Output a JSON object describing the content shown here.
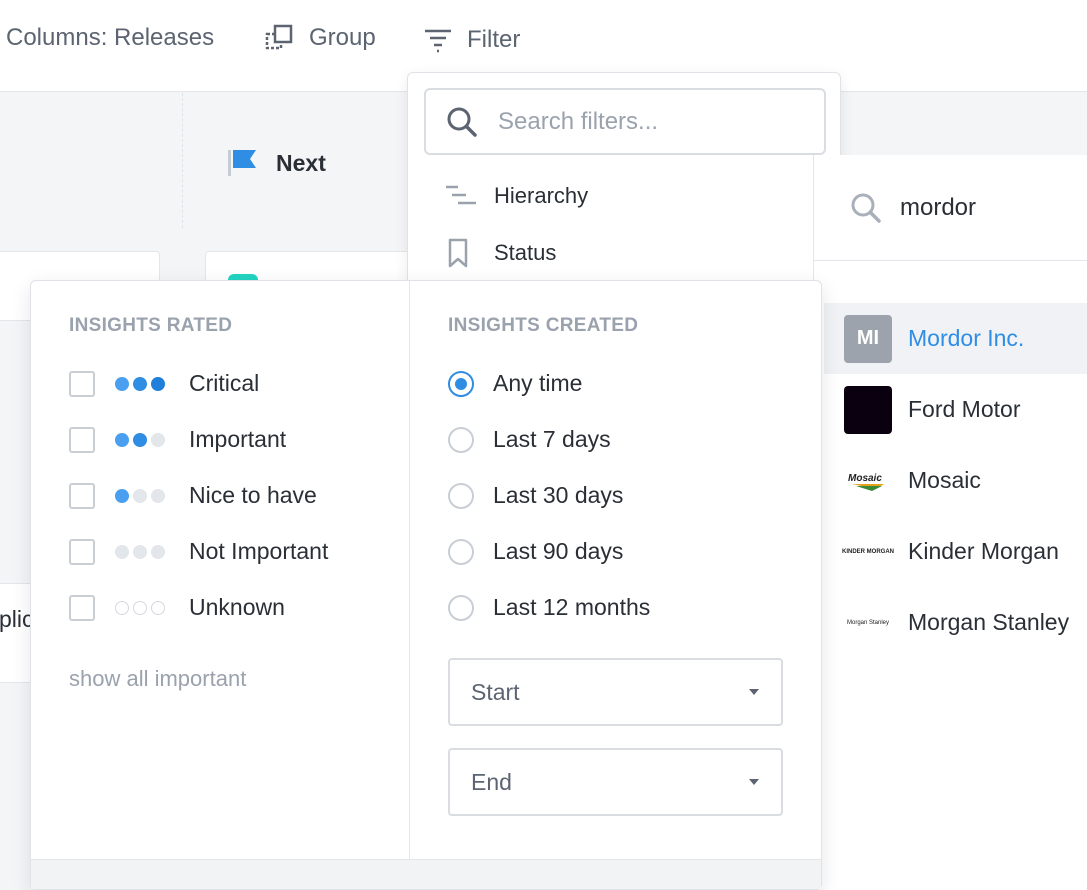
{
  "toolbar": {
    "columns_label": "Columns: Releases",
    "group_label": "Group",
    "filter_label": "Filter"
  },
  "board": {
    "column_title": "Next",
    "partial_card_text": "plic"
  },
  "filter_menu": {
    "search_placeholder": "Search filters...",
    "items": [
      {
        "label": "Hierarchy",
        "icon": "hierarchy-icon"
      },
      {
        "label": "Status",
        "icon": "bookmark-icon"
      }
    ]
  },
  "customer_search": {
    "query": "mordor",
    "results": [
      {
        "name": "Mordor Inc.",
        "logo": "MI",
        "selected": true
      },
      {
        "name": "Ford Motor",
        "logo": "",
        "selected": false
      },
      {
        "name": "Mosaic",
        "logo": "Mosaic",
        "selected": false
      },
      {
        "name": "Kinder Morgan",
        "logo": "KINDER MORGAN",
        "selected": false
      },
      {
        "name": "Morgan Stanley",
        "logo": "Morgan Stanley",
        "selected": false
      }
    ]
  },
  "insights_rated": {
    "title": "INSIGHTS RATED",
    "options": [
      {
        "label": "Critical",
        "level": 3,
        "checked": false
      },
      {
        "label": "Important",
        "level": 2,
        "checked": false
      },
      {
        "label": "Nice to have",
        "level": 1,
        "checked": false
      },
      {
        "label": "Not Important",
        "level": 0,
        "checked": false
      },
      {
        "label": "Unknown",
        "level": -1,
        "checked": false
      }
    ],
    "show_all_label": "show all important"
  },
  "insights_created": {
    "title": "INSIGHTS CREATED",
    "options": [
      {
        "label": "Any time",
        "selected": true
      },
      {
        "label": "Last 7 days",
        "selected": false
      },
      {
        "label": "Last 30 days",
        "selected": false
      },
      {
        "label": "Last 90 days",
        "selected": false
      },
      {
        "label": "Last 12 months",
        "selected": false
      }
    ],
    "start_label": "Start",
    "end_label": "End"
  },
  "colors": {
    "accent": "#2f8de4",
    "dot_on": "#2f8de4",
    "dot_off": "#e3e6ea",
    "muted": "#9aa2ad"
  }
}
